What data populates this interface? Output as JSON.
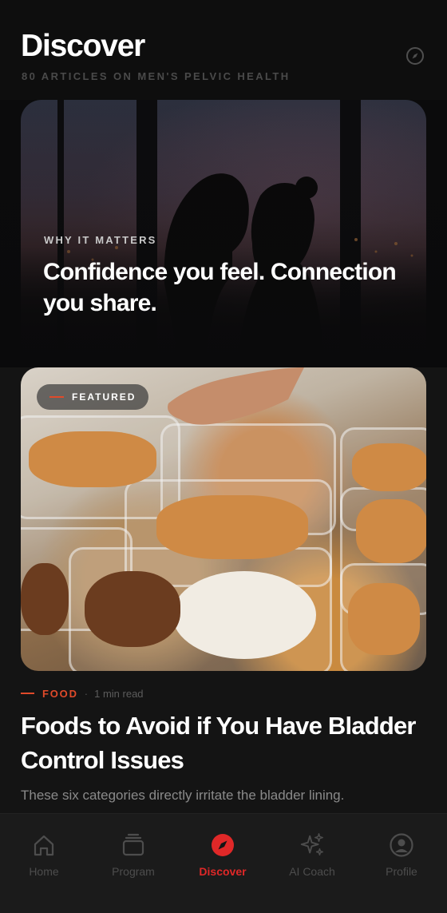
{
  "header": {
    "title": "Discover",
    "subtitle": "80 ARTICLES ON MEN'S PELVIC HEALTH",
    "action_icon": "compass-icon"
  },
  "hero": {
    "eyebrow": "WHY IT MATTERS",
    "headline": "Confidence you feel. Connection you share.",
    "image": "couple-silhouette-city-dusk"
  },
  "featured_article": {
    "badge": "FEATURED",
    "category": "FOOD",
    "separator": "·",
    "read_time": "1 min read",
    "title": "Foods to Avoid if You Have Bladder Control Issues",
    "description": "These six categories directly irritate the bladder lining.",
    "image": "meal-prep-containers-rice-chicken"
  },
  "tabbar": {
    "tabs": [
      {
        "label": "Home",
        "icon": "home-icon",
        "active": false
      },
      {
        "label": "Program",
        "icon": "program-stack-icon",
        "active": false
      },
      {
        "label": "Discover",
        "icon": "compass-icon",
        "active": true
      },
      {
        "label": "AI Coach",
        "icon": "sparkles-icon",
        "active": false
      },
      {
        "label": "Profile",
        "icon": "user-circle-icon",
        "active": false
      }
    ]
  },
  "colors": {
    "accent": "#e02828",
    "category_accent": "#e04a2a",
    "background": "#141414"
  }
}
